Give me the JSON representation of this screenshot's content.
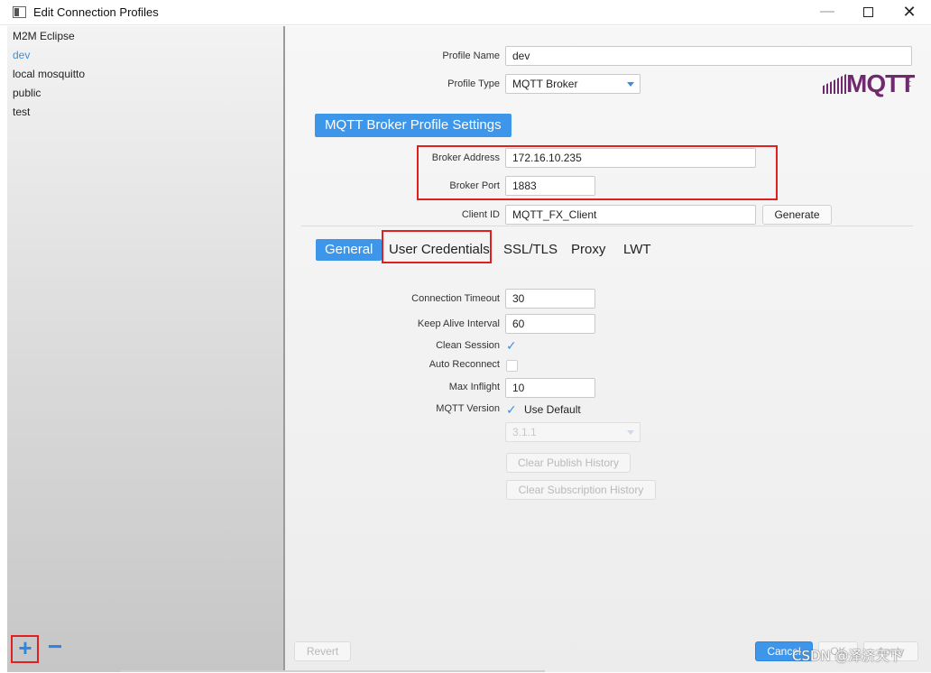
{
  "window": {
    "title": "Edit Connection Profiles",
    "min_glyph": "—",
    "close_glyph": "✕"
  },
  "sidebar": {
    "profiles": [
      {
        "name": "M2M Eclipse",
        "selected": false
      },
      {
        "name": "dev",
        "selected": true
      },
      {
        "name": "local mosquitto",
        "selected": false
      },
      {
        "name": "public",
        "selected": false
      },
      {
        "name": "test",
        "selected": false
      }
    ],
    "add_glyph": "+",
    "remove_glyph": "−"
  },
  "profile": {
    "name_label": "Profile Name",
    "name_value": "dev",
    "type_label": "Profile Type",
    "type_value": "MQTT Broker"
  },
  "logo": {
    "text": "MQTT",
    "small": "3.1.1"
  },
  "broker": {
    "section_title": "MQTT Broker Profile Settings",
    "address_label": "Broker Address",
    "address_value": "172.16.10.235",
    "port_label": "Broker Port",
    "port_value": "1883",
    "client_id_label": "Client ID",
    "client_id_value": "MQTT_FX_Client",
    "generate_label": "Generate"
  },
  "tabs": [
    {
      "label": "General",
      "active": true
    },
    {
      "label": "User Credentials",
      "active": false
    },
    {
      "label": "SSL/TLS",
      "active": false
    },
    {
      "label": "Proxy",
      "active": false
    },
    {
      "label": "LWT",
      "active": false
    }
  ],
  "general": {
    "connection_timeout_label": "Connection Timeout",
    "connection_timeout_value": "30",
    "keep_alive_label": "Keep Alive Interval",
    "keep_alive_value": "60",
    "clean_session_label": "Clean Session",
    "clean_session_checked": true,
    "auto_reconnect_label": "Auto Reconnect",
    "auto_reconnect_checked": false,
    "max_inflight_label": "Max Inflight",
    "max_inflight_value": "10",
    "mqtt_version_label": "MQTT Version",
    "use_default_label": "Use Default",
    "use_default_checked": true,
    "version_value": "3.1.1",
    "clear_publish_label": "Clear Publish History",
    "clear_subscription_label": "Clear Subscription History"
  },
  "footer": {
    "revert_label": "Revert",
    "cancel_label": "Cancel",
    "ok_label": "OK",
    "apply_label": "Apply"
  },
  "watermark": "CSDN @泽济天下",
  "colors": {
    "accent": "#3d96ea",
    "highlight": "#e02020",
    "logo": "#6f2a6d"
  }
}
